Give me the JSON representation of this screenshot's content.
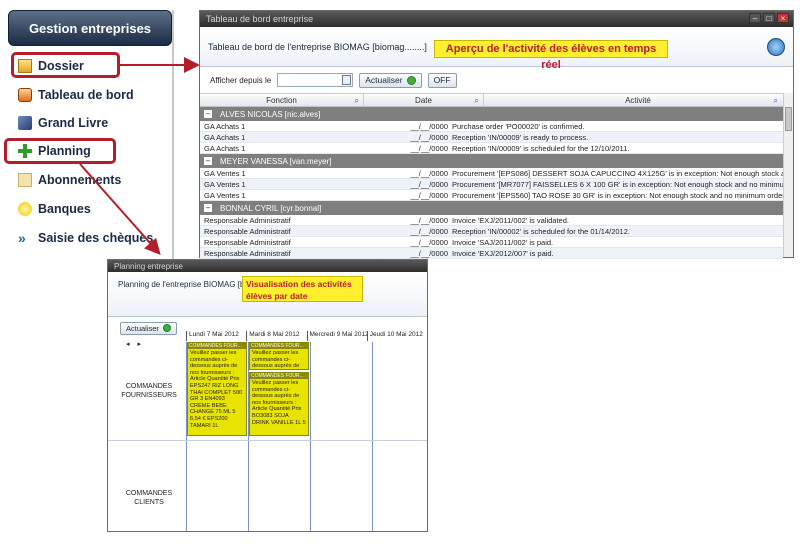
{
  "menu": {
    "header": "Gestion entreprises",
    "items": [
      {
        "label": "Dossier",
        "icon": "folder-icon"
      },
      {
        "label": "Tableau de bord",
        "icon": "dashboard-icon"
      },
      {
        "label": "Grand Livre",
        "icon": "ledger-icon"
      },
      {
        "label": "Planning",
        "icon": "plus-icon"
      },
      {
        "label": "Abonnements",
        "icon": "subscriptions-icon"
      },
      {
        "label": "Banques",
        "icon": "bank-icon"
      },
      {
        "label": "Saisie des chèques",
        "icon": "cheque-icon"
      }
    ]
  },
  "dashboard": {
    "window_title": "Tableau de bord entreprise",
    "header_title": "Tableau de bord de l'entreprise BIOMAG [biomag........]",
    "callout": "Aperçu de l'activité des élèves en temps réel",
    "since_label": "Afficher depuis le",
    "refresh_label": "Actualiser",
    "off_label": "OFF",
    "columns": [
      "Fonction",
      "Date",
      "Activité"
    ],
    "groups": [
      {
        "name": "ALVES NICOLAS [nic.alves]",
        "rows": [
          {
            "fonction": "GA Achats 1",
            "date": "__/__/0000",
            "activite": "Purchase order 'PO00020' is confirmed."
          },
          {
            "fonction": "GA Achats 1",
            "date": "__/__/0000",
            "activite": "Reception 'IN/00009' is ready to process."
          },
          {
            "fonction": "GA Achats 1",
            "date": "__/__/0000",
            "activite": "Reception 'IN/00009' is scheduled for the 12/10/2011."
          }
        ]
      },
      {
        "name": "MEYER VANESSA [van.meyer]",
        "rows": [
          {
            "fonction": "GA Ventes 1",
            "date": "__/__/0000",
            "activite": "Procurement '[EPS086] DESSERT SOJA CAPUCCINO 4X125G' is in exception: Not enough stock and no minimum orderpoint rule defined."
          },
          {
            "fonction": "GA Ventes 1",
            "date": "__/__/0000",
            "activite": "Procurement '[MR7077] FAISSELLES 6 X 100 GR' is in exception: Not enough stock and no minimum orderpoint rule defined."
          },
          {
            "fonction": "GA Ventes 1",
            "date": "__/__/0000",
            "activite": "Procurement '[EPS560] TAO ROSE 30 GR' is in exception: Not enough stock and no minimum orderpoint rule defined."
          }
        ]
      },
      {
        "name": "BONNAL CYRIL [cyr.bonnal]",
        "rows": [
          {
            "fonction": "Responsable Administratif",
            "date": "__/__/0000",
            "activite": "Invoice 'EXJ/2011/002' is validated."
          },
          {
            "fonction": "Responsable Administratif",
            "date": "__/__/0000",
            "activite": "Reception 'IN/00002' is scheduled for the 01/14/2012."
          },
          {
            "fonction": "Responsable Administratif",
            "date": "__/__/0000",
            "activite": "Invoice 'SAJ/2011/002' is paid."
          },
          {
            "fonction": "Responsable Administratif",
            "date": "__/__/0000",
            "activite": "Invoice 'EXJ/2012/007' is paid."
          }
        ]
      }
    ]
  },
  "planning": {
    "window_title": "Planning entreprise",
    "header_title": "Planning de l'entreprise BIOMAG [biomag",
    "callout": "Visualisation des activités élèves par date",
    "refresh_label": "Actualiser",
    "nav_prev": "◂",
    "nav_next": "▸",
    "days": [
      "Lundi 7 Mai 2012",
      "Mardi 8 Mai 2012",
      "Mercredi 9 Mai 2012",
      "Jeudi 10 Mai 2012"
    ],
    "rows": [
      "COMMANDES FOURNISSEURS",
      "COMMANDES CLIENTS"
    ],
    "events": [
      {
        "header": "COMMANDES FOUR...",
        "body": "Veuillez passer les commandes ci-dessous auprès de nos fournisseurs : Article Quantité Prix EPS247 RIZ LONG THAI COMPLET 500 GR 3 EN4093 CREME BEBE CHANGE 75 ML 5 6,54 € EPS200 TAMARI 1L"
      },
      {
        "header": "COMMANDES FOUR...",
        "body": "Veuillez passer les commandes ci-dessous auprès de nos fournisseurs"
      },
      {
        "header": "COMMANDES FOUR...",
        "body": "Veuillez passer les commandes ci-dessous auprès de nos fournisseurs : Article Quantité Prix BO3083 SOJA DRINK VANILLE 1L 5"
      }
    ]
  }
}
